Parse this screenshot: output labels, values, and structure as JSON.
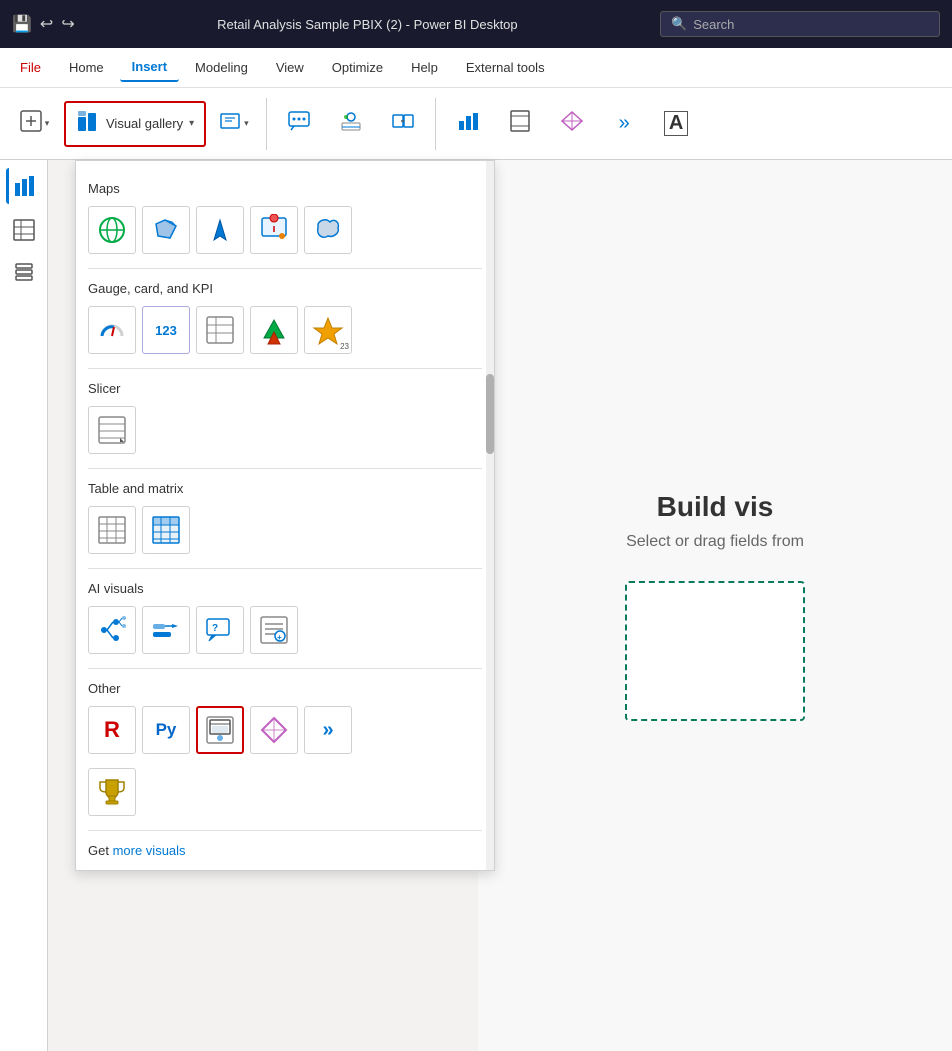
{
  "titleBar": {
    "appTitle": "Retail Analysis Sample PBIX (2) - Power BI Desktop",
    "searchPlaceholder": "Search",
    "icons": {
      "save": "💾",
      "undo": "↩",
      "redo": "↪"
    }
  },
  "menuBar": {
    "items": [
      {
        "id": "file",
        "label": "File"
      },
      {
        "id": "home",
        "label": "Home"
      },
      {
        "id": "insert",
        "label": "Insert",
        "active": true
      },
      {
        "id": "modeling",
        "label": "Modeling"
      },
      {
        "id": "view",
        "label": "View"
      },
      {
        "id": "optimize",
        "label": "Optimize"
      },
      {
        "id": "help",
        "label": "Help"
      },
      {
        "id": "external-tools",
        "label": "External tools"
      }
    ]
  },
  "ribbon": {
    "buttons": [
      {
        "id": "new-visual",
        "icon": "⊞",
        "label": ""
      },
      {
        "id": "visual-gallery",
        "label": "Visual gallery",
        "icon": "📊",
        "highlighted": true
      },
      {
        "id": "text-box",
        "icon": "T",
        "label": ""
      },
      {
        "id": "comment",
        "icon": "💬",
        "label": ""
      },
      {
        "id": "button2",
        "icon": "⬜",
        "label": ""
      },
      {
        "id": "transform",
        "icon": "⇄",
        "label": ""
      },
      {
        "id": "chart-bar",
        "icon": "📈",
        "label": ""
      },
      {
        "id": "page",
        "icon": "📄",
        "label": ""
      },
      {
        "id": "diamond",
        "icon": "◇",
        "label": ""
      },
      {
        "id": "chevron",
        "icon": "»",
        "label": ""
      },
      {
        "id": "text-a",
        "icon": "A",
        "label": ""
      }
    ]
  },
  "sidebar": {
    "icons": [
      {
        "id": "bar-chart",
        "icon": "📊",
        "active": true
      },
      {
        "id": "table",
        "icon": "⊞"
      },
      {
        "id": "layers",
        "icon": "⧉"
      }
    ]
  },
  "visualGalleryDropdown": {
    "sections": [
      {
        "id": "maps",
        "label": "Maps",
        "icons": [
          {
            "id": "globe",
            "symbol": "🌐",
            "title": "Globe map"
          },
          {
            "id": "choropleth",
            "symbol": "🗺",
            "title": "Choropleth map"
          },
          {
            "id": "navigation",
            "symbol": "🔺",
            "title": "Navigation map"
          },
          {
            "id": "pin-map",
            "symbol": "📍",
            "title": "Pin map"
          },
          {
            "id": "shape-map",
            "symbol": "🦅",
            "title": "Shape map"
          }
        ]
      },
      {
        "id": "gauge-card-kpi",
        "label": "Gauge, card, and KPI",
        "icons": [
          {
            "id": "gauge",
            "symbol": "🌡",
            "title": "Gauge"
          },
          {
            "id": "card-123",
            "symbol": "123",
            "title": "Card",
            "text": true
          },
          {
            "id": "multi-row",
            "symbol": "≡",
            "title": "Multi-row card"
          },
          {
            "id": "kpi",
            "symbol": "⬆",
            "title": "KPI"
          },
          {
            "id": "smart-narrative",
            "symbol": "⚡",
            "title": "Smart narrative",
            "badge": "23"
          }
        ]
      },
      {
        "id": "slicer",
        "label": "Slicer",
        "icons": [
          {
            "id": "slicer-icon",
            "symbol": "▦",
            "title": "Slicer"
          }
        ]
      },
      {
        "id": "table-matrix",
        "label": "Table and matrix",
        "icons": [
          {
            "id": "table-icon",
            "symbol": "▦",
            "title": "Table"
          },
          {
            "id": "matrix-icon",
            "symbol": "▤",
            "title": "Matrix",
            "colored": true
          }
        ]
      },
      {
        "id": "ai-visuals",
        "label": "AI visuals",
        "icons": [
          {
            "id": "decomp-tree",
            "symbol": "⊶",
            "title": "Decomposition tree"
          },
          {
            "id": "influence",
            "symbol": "⇢",
            "title": "Key influencers"
          },
          {
            "id": "qa-visual",
            "symbol": "💬",
            "title": "Q&A"
          },
          {
            "id": "smart-narrative2",
            "symbol": "📄",
            "title": "Smart narrative"
          }
        ]
      },
      {
        "id": "other",
        "label": "Other",
        "icons": [
          {
            "id": "r-visual",
            "symbol": "R",
            "title": "R script visual",
            "color": "#c00",
            "bold": true
          },
          {
            "id": "python-visual",
            "symbol": "Py",
            "title": "Python visual",
            "color": "#0066cc",
            "bold": true
          },
          {
            "id": "power-automate",
            "symbol": "🗄",
            "title": "Power Automate",
            "selected": true
          },
          {
            "id": "fabric-diamond",
            "symbol": "◈",
            "title": "Fabric visual",
            "color": "#c060c0"
          },
          {
            "id": "chevron-icon",
            "symbol": "»",
            "title": "More visuals",
            "color": "#0078d4"
          }
        ],
        "extraIcons": [
          {
            "id": "trophy",
            "symbol": "🏆",
            "title": "Achievement"
          }
        ]
      }
    ],
    "getMoreVisuals": "Get more visuals",
    "getMoreVisualsLinkColor": "#0078d4"
  },
  "contentArea": {
    "buildTitle": "Build vis",
    "buildSubtitle": "Select or drag fields from"
  }
}
